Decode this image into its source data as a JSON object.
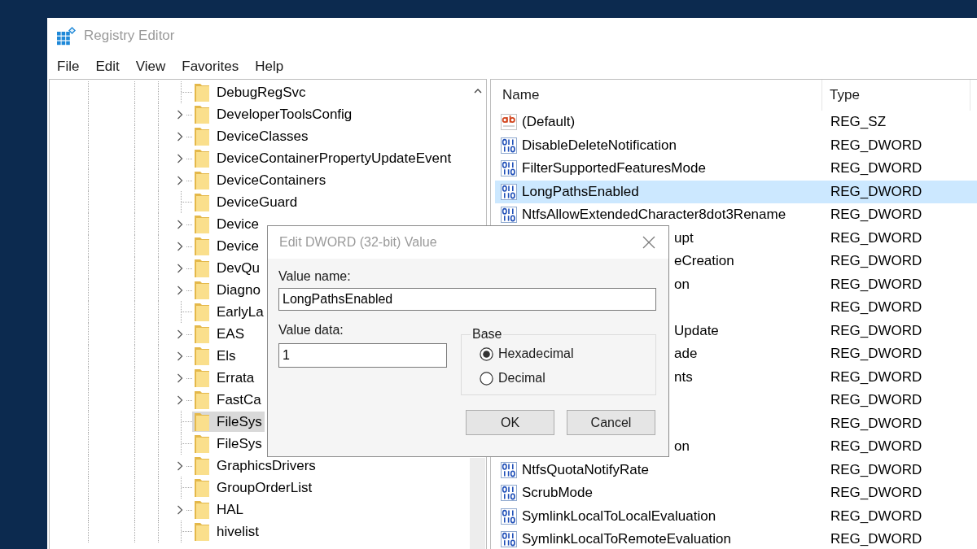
{
  "window": {
    "title": "Registry Editor"
  },
  "menu": [
    "File",
    "Edit",
    "View",
    "Favorites",
    "Help"
  ],
  "tree": {
    "items": [
      {
        "label": "DebugRegSvc",
        "expandable": false,
        "selected": false
      },
      {
        "label": "DeveloperToolsConfig",
        "expandable": true,
        "selected": false
      },
      {
        "label": "DeviceClasses",
        "expandable": true,
        "selected": false
      },
      {
        "label": "DeviceContainerPropertyUpdateEvent",
        "expandable": true,
        "selected": false
      },
      {
        "label": "DeviceContainers",
        "expandable": true,
        "selected": false
      },
      {
        "label": "DeviceGuard",
        "expandable": false,
        "selected": false
      },
      {
        "label": "Device",
        "expandable": true,
        "selected": false
      },
      {
        "label": "Device",
        "expandable": true,
        "selected": false
      },
      {
        "label": "DevQu",
        "expandable": true,
        "selected": false
      },
      {
        "label": "Diagno",
        "expandable": true,
        "selected": false
      },
      {
        "label": "EarlyLa",
        "expandable": false,
        "selected": false
      },
      {
        "label": "EAS",
        "expandable": true,
        "selected": false
      },
      {
        "label": "Els",
        "expandable": true,
        "selected": false
      },
      {
        "label": "Errata",
        "expandable": true,
        "selected": false
      },
      {
        "label": "FastCa",
        "expandable": true,
        "selected": false
      },
      {
        "label": "FileSys",
        "expandable": false,
        "selected": true
      },
      {
        "label": "FileSys",
        "expandable": false,
        "selected": false
      },
      {
        "label": "GraphicsDrivers",
        "expandable": true,
        "selected": false
      },
      {
        "label": "GroupOrderList",
        "expandable": false,
        "selected": false
      },
      {
        "label": "HAL",
        "expandable": true,
        "selected": false
      },
      {
        "label": "hivelist",
        "expandable": false,
        "selected": false
      }
    ]
  },
  "values": {
    "columns": [
      "Name",
      "Type"
    ],
    "rows": [
      {
        "kind": "string",
        "name": "(Default)",
        "type": "REG_SZ",
        "selected": false
      },
      {
        "kind": "binary",
        "name": "DisableDeleteNotification",
        "type": "REG_DWORD",
        "selected": false
      },
      {
        "kind": "binary",
        "name": "FilterSupportedFeaturesMode",
        "type": "REG_DWORD",
        "selected": false
      },
      {
        "kind": "binary",
        "name": "LongPathsEnabled",
        "type": "REG_DWORD",
        "selected": true
      },
      {
        "kind": "binary",
        "name": "NtfsAllowExtendedCharacter8dot3Rename",
        "type": "REG_DWORD",
        "selected": false
      },
      {
        "kind": "covered",
        "name": "upt",
        "type": "REG_DWORD",
        "selected": false
      },
      {
        "kind": "covered",
        "name": "eCreation",
        "type": "REG_DWORD",
        "selected": false
      },
      {
        "kind": "covered",
        "name": "on",
        "type": "REG_DWORD",
        "selected": false
      },
      {
        "kind": "covered",
        "type": "REG_DWORD",
        "selected": false
      },
      {
        "kind": "covered",
        "name": "Update",
        "type": "REG_DWORD",
        "selected": false
      },
      {
        "kind": "covered",
        "name": "ade",
        "type": "REG_DWORD",
        "selected": false
      },
      {
        "kind": "covered",
        "name": "nts",
        "type": "REG_DWORD",
        "selected": false
      },
      {
        "kind": "covered",
        "type": "REG_DWORD",
        "selected": false
      },
      {
        "kind": "covered",
        "type": "REG_DWORD",
        "selected": false
      },
      {
        "kind": "covered",
        "name": "on",
        "type": "REG_DWORD",
        "selected": false
      },
      {
        "kind": "binary",
        "name": "NtfsQuotaNotifyRate",
        "type": "REG_DWORD",
        "selected": false
      },
      {
        "kind": "binary",
        "name": "ScrubMode",
        "type": "REG_DWORD",
        "selected": false
      },
      {
        "kind": "binary",
        "name": "SymlinkLocalToLocalEvaluation",
        "type": "REG_DWORD",
        "selected": false
      },
      {
        "kind": "binary",
        "name": "SymlinkLocalToRemoteEvaluation",
        "type": "REG_DWORD",
        "selected": false
      }
    ]
  },
  "dialog": {
    "title": "Edit DWORD (32-bit) Value",
    "value_name_label": "Value name:",
    "value_name": "LongPathsEnabled",
    "value_data_label": "Value data:",
    "value_data": "1",
    "base": {
      "label": "Base",
      "options": [
        {
          "label": "Hexadecimal",
          "selected": true
        },
        {
          "label": "Decimal",
          "selected": false
        }
      ]
    },
    "buttons": [
      "OK",
      "Cancel"
    ]
  }
}
